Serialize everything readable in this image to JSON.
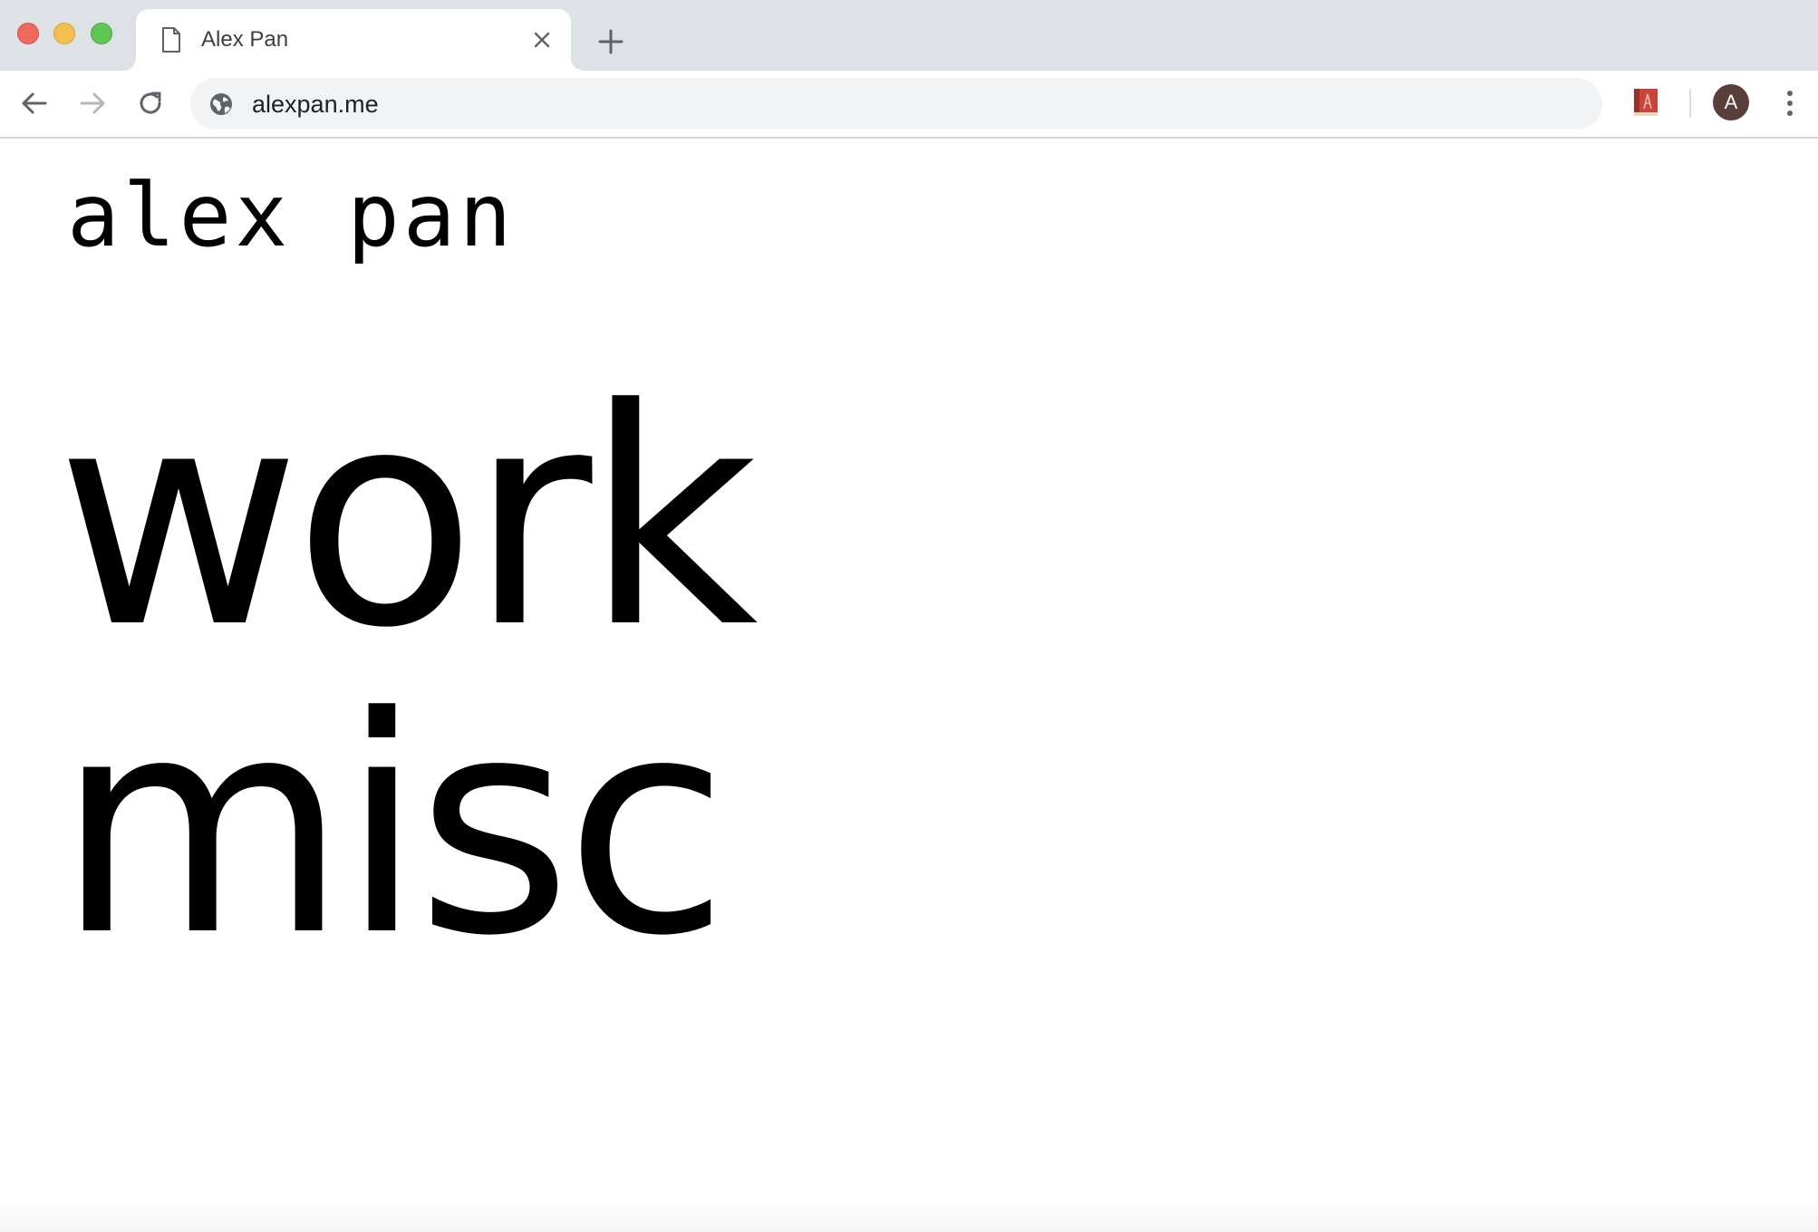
{
  "window": {
    "controls": [
      "close",
      "minimize",
      "maximize"
    ]
  },
  "tab": {
    "title": "Alex Pan",
    "icon": "page-icon"
  },
  "toolbar": {
    "url": "alexpan.me",
    "site_icon": "globe-icon",
    "avatar_letter": "A"
  },
  "colors": {
    "tabstrip_bg": "#dee1e6",
    "omnibox_bg": "#f1f3f4",
    "avatar_bg": "#5a3e3a",
    "close_btn": "#ed6a5e",
    "minimize_btn": "#f5bf4f",
    "maximize_btn": "#61c554"
  },
  "page": {
    "site_name": "alex pan",
    "nav": [
      {
        "label": "work"
      },
      {
        "label": "misc"
      }
    ]
  }
}
